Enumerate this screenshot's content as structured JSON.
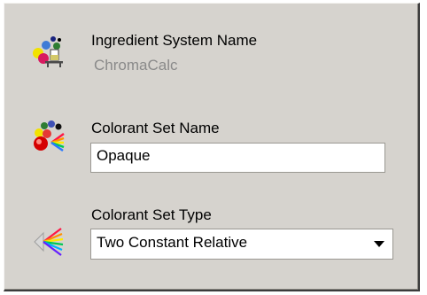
{
  "ingredient_system": {
    "label": "Ingredient System Name",
    "value": "ChromaCalc",
    "icon": "ingredient-system-icon"
  },
  "colorant_set_name": {
    "label": "Colorant Set Name",
    "value": "Opaque",
    "icon": "colorant-set-icon"
  },
  "colorant_set_type": {
    "label": "Colorant Set Type",
    "selected": "Two Constant Relative",
    "icon": "colorant-type-icon"
  },
  "colors": {
    "panel": "#d6d3ce",
    "disabled_text": "#8a8a8a"
  }
}
